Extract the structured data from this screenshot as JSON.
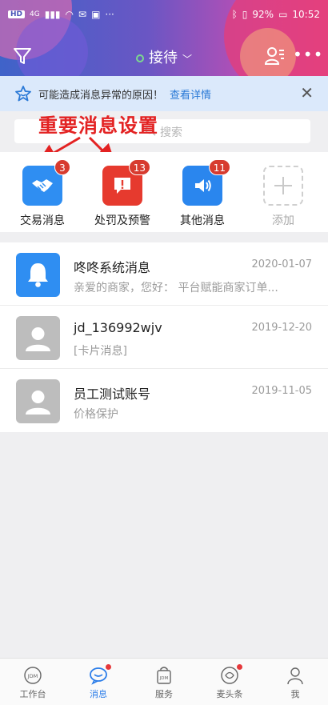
{
  "status_bar": {
    "left_indicators": [
      "HD",
      "4G"
    ],
    "battery": "92%",
    "time": "10:52"
  },
  "header": {
    "title": "接待",
    "status_color": "#7bd88f"
  },
  "notice": {
    "text": "可能造成消息异常的原因！",
    "link": "查看详情"
  },
  "search": {
    "placeholder": "搜索"
  },
  "annotation": {
    "text": "重要消息设置",
    "color": "#e32222"
  },
  "categories": [
    {
      "label": "交易消息",
      "badge": "3",
      "icon": "handshake-icon",
      "color": "#2f8ef2"
    },
    {
      "label": "处罚及预警",
      "badge": "13",
      "icon": "alert-icon",
      "color": "#e63a2e"
    },
    {
      "label": "其他消息",
      "badge": "11",
      "icon": "speaker-icon",
      "color": "#2a86ee"
    },
    {
      "label": "添加",
      "badge": "",
      "icon": "plus-icon",
      "color": "#cfcfcf"
    }
  ],
  "messages": [
    {
      "name": "咚咚系统消息",
      "time": "2020-01-07",
      "preview": "亲爱的商家，您好： 平台赋能商家订单...",
      "avatar": "bell-icon"
    },
    {
      "name": "jd_136992wjv",
      "time": "2019-12-20",
      "preview": "[卡片消息]",
      "avatar": "user-icon"
    },
    {
      "name": "员工测试账号",
      "time": "2019-11-05",
      "preview": "价格保护",
      "avatar": "user-icon"
    }
  ],
  "tabs": [
    {
      "label": "工作台",
      "icon": "jdm-icon",
      "active": false,
      "dot": false
    },
    {
      "label": "消息",
      "icon": "chat-icon",
      "active": true,
      "dot": true
    },
    {
      "label": "服务",
      "icon": "bag-icon",
      "active": false,
      "dot": false
    },
    {
      "label": "麦头条",
      "icon": "news-icon",
      "active": false,
      "dot": true
    },
    {
      "label": "我",
      "icon": "profile-icon",
      "active": false,
      "dot": false
    }
  ],
  "colors": {
    "accent": "#2b7de9",
    "badge": "#d73b2f"
  }
}
